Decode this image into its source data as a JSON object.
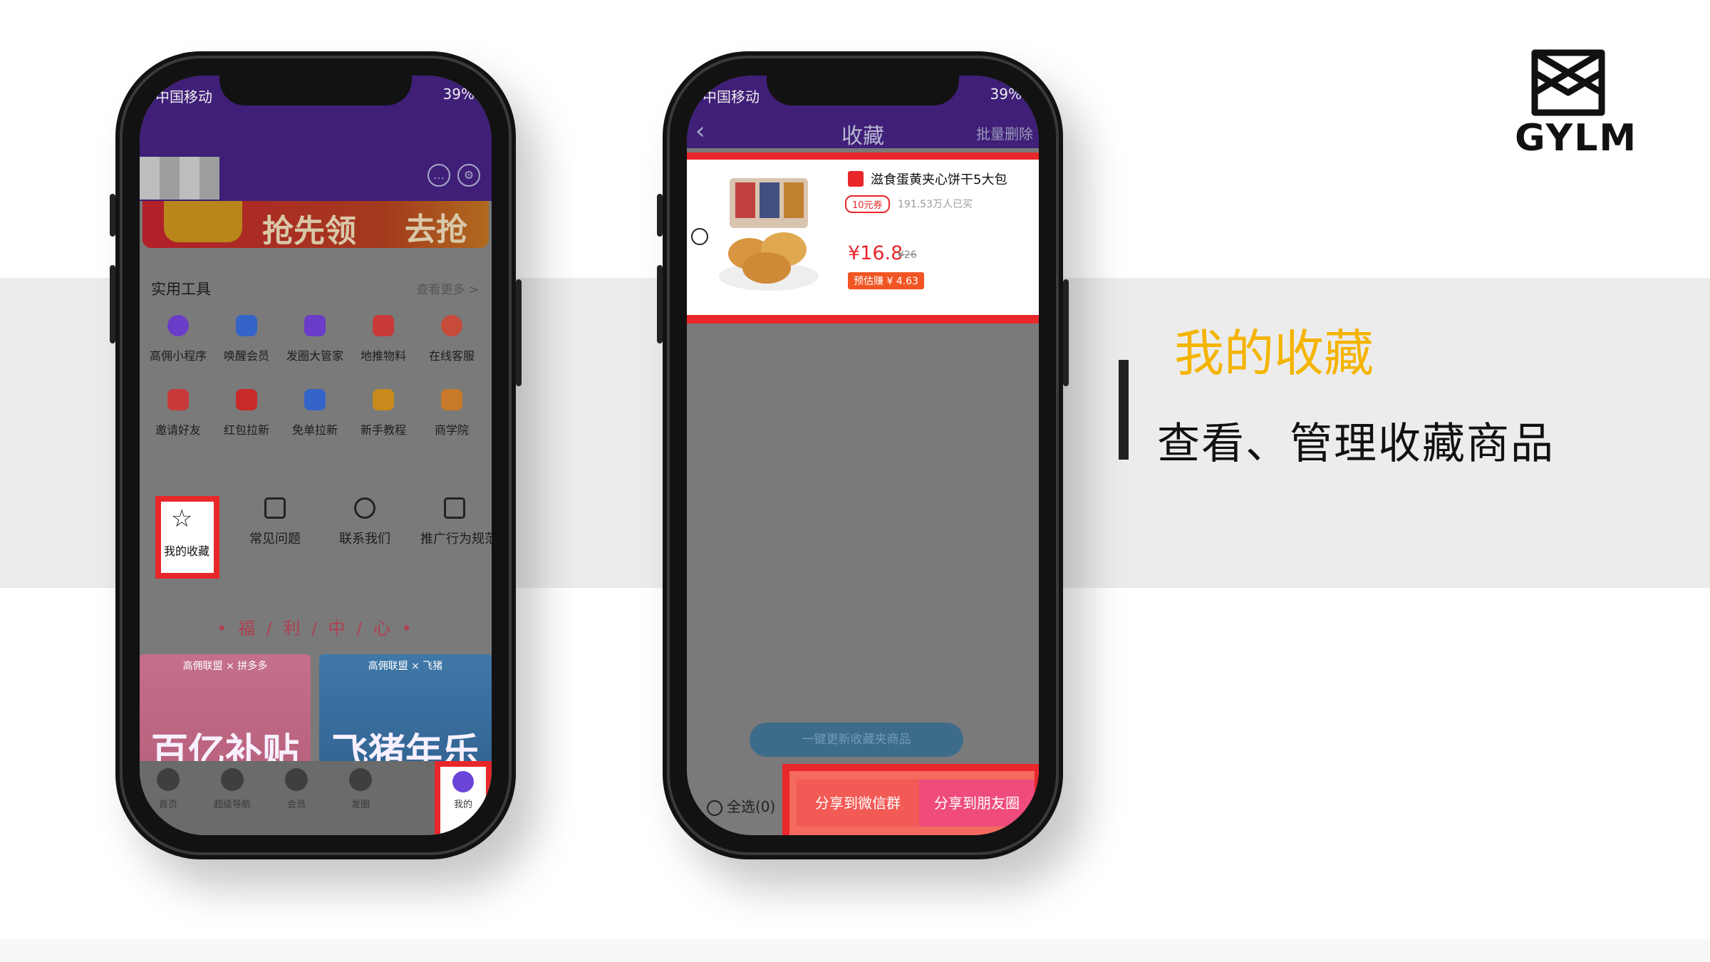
{
  "brand": {
    "logo_text": "GYLM"
  },
  "feature": {
    "title": "我的收藏",
    "subtitle": "查看、管理收藏商品"
  },
  "colors": {
    "accent_yellow": "#f5b400",
    "highlight_red": "#e8272b",
    "header_purple": "#3f1f78"
  },
  "left_phone": {
    "status": {
      "carrier": "中国移动",
      "battery": "39%"
    },
    "banner": {
      "left": "抢先领",
      "right": "去抢"
    },
    "tools": {
      "title": "实用工具",
      "more": "查看更多 >",
      "items": [
        "高佣小程序",
        "唤醒会员",
        "发圈大管家",
        "地推物料",
        "在线客服",
        "邀请好友",
        "红包拉新",
        "免单拉新",
        "新手教程",
        "商学院"
      ]
    },
    "row3": {
      "favorites": "我的收藏",
      "faq": "常见问题",
      "contact": "联系我们",
      "rules": "推广行为规范"
    },
    "welfare": "• 福 / 利 / 中 / 心 •",
    "promos": [
      {
        "tag": "高佣联盟 × 拼多多",
        "text": "百亿补贴节 年末狂补"
      },
      {
        "tag": "高佣联盟 × 飞猪",
        "text": "飞猪年乐 交通会场"
      }
    ],
    "tabs": [
      "首页",
      "超级导航",
      "会员",
      "发圈",
      "我的"
    ]
  },
  "right_phone": {
    "status": {
      "carrier": "中国移动",
      "battery": "39%"
    },
    "header": {
      "title": "收藏",
      "bulk_delete": "批量删除"
    },
    "product": {
      "name": "滋食蛋黄夹心饼干5大包",
      "coupon": "10元券",
      "sold": "191.53万人已买",
      "price": "¥16.8",
      "old_price": "¥26",
      "earn": "预估赚 ¥ 4.63"
    },
    "update_button": "一键更新收藏夹商品",
    "select_all": "全选(0)",
    "share_group": "分享到微信群",
    "share_moments": "分享到朋友圈"
  }
}
